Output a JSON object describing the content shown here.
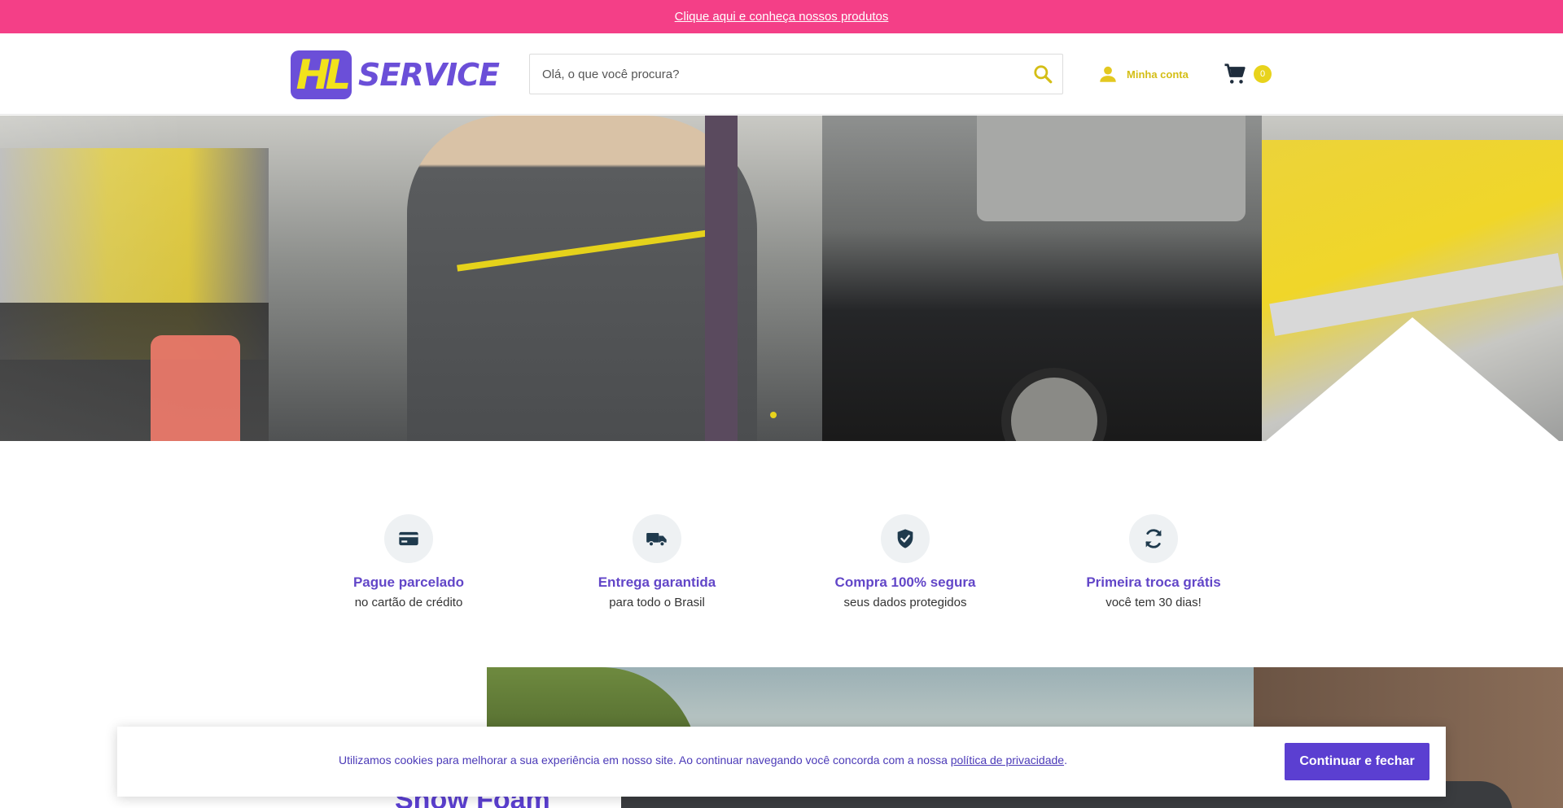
{
  "topbar": {
    "link_text": "Clique aqui e conheça nossos produtos"
  },
  "header": {
    "logo_mark": "HL",
    "logo_text": "SERVICE",
    "search_placeholder": "Olá, o que você procura?",
    "account_label": "Minha conta",
    "cart_count": "0"
  },
  "hero": {
    "slide_dots": 1,
    "active_slide": 1
  },
  "features": [
    {
      "icon": "credit-card-icon",
      "title": "Pague parcelado",
      "subtitle": "no cartão de crédito"
    },
    {
      "icon": "truck-icon",
      "title": "Entrega garantida",
      "subtitle": "para todo o Brasil"
    },
    {
      "icon": "shield-check-icon",
      "title": "Compra 100% segura",
      "subtitle": "seus dados protegidos"
    },
    {
      "icon": "refresh-icon",
      "title": "Primeira troca grátis",
      "subtitle": "você tem 30 dias!"
    }
  ],
  "promo": {
    "title": "Snow Foam"
  },
  "cookie": {
    "message": "Utilizamos cookies para melhorar a sua experiência em nosso site. Ao continuar navegando você concorda com a nossa ",
    "policy_link": "política de privacidade",
    "period": ".",
    "button_label": "Continuar e fechar"
  },
  "colors": {
    "topbar": "#f43f87",
    "brand_purple": "#6b4fd8",
    "brand_yellow": "#e8d31c",
    "feature_title": "#6246c8",
    "button": "#5b3fd1"
  }
}
